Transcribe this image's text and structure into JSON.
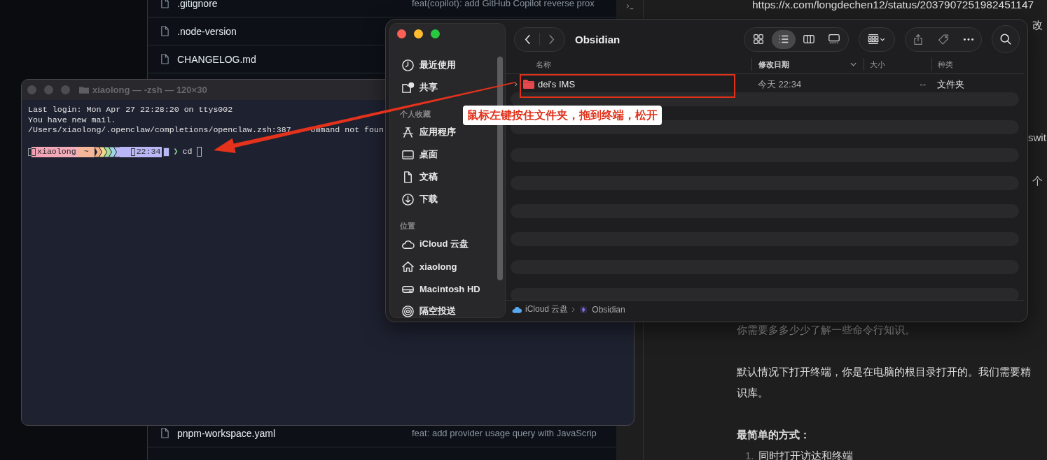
{
  "browser": {
    "files_top": [
      {
        "name": ".gitignore",
        "commit": "feat(copilot): add GitHub Copilot reverse prox"
      },
      {
        "name": ".node-version"
      },
      {
        "name": "CHANGELOG.md"
      }
    ],
    "files_bottom": [
      {
        "name": "pnpm-workspace.yaml",
        "commit": "feat: add provider usage query with JavaScrip"
      }
    ]
  },
  "note": {
    "url": "https://x.com/longdechen12/status/2037907251982451147",
    "edge_fragments": [
      "改",
      "swit",
      "个"
    ],
    "paragraphs": [
      {
        "kind": "muted",
        "lines": [
          "你需要多多少少了解一些命令行知识。"
        ]
      },
      {
        "kind": "normal",
        "lines": [
          "默认情况下打开终端，你是在电脑的根目录打开的。我们需要精",
          "识库。"
        ]
      },
      {
        "kind": "heading",
        "lines": [
          "最简单的方式："
        ]
      }
    ],
    "list": [
      {
        "number": "1.",
        "text": "同时打开访达和终端"
      }
    ]
  },
  "terminal": {
    "title": "xiaolong — -zsh — 120×30",
    "lines": [
      "Last login: Mon Apr 27 22:28:20 on ttys002",
      "You have new mail.",
      {
        "shown": "/Users/xiaolong/.openclaw/completions/openclaw.zsh:387",
        "after_arrow": "ommand not foun"
      }
    ],
    "prompt": {
      "user": "xiaolong",
      "dir": "~",
      "time": "22:34",
      "symbol": "❯",
      "command": "cd"
    }
  },
  "finder": {
    "title": "Obsidian",
    "view_modes": [
      {
        "kind": "icons",
        "selected": false
      },
      {
        "kind": "list",
        "selected": true
      },
      {
        "kind": "columns",
        "selected": false
      },
      {
        "kind": "gallery",
        "selected": false
      }
    ],
    "sidebar": [
      {
        "items": [
          {
            "kind": "clock",
            "label": "最近使用"
          },
          {
            "kind": "shared",
            "label": "共享"
          }
        ]
      },
      {
        "title": "个人收藏",
        "items": [
          {
            "kind": "apps",
            "label": "应用程序"
          },
          {
            "kind": "desktop",
            "label": "桌面"
          },
          {
            "kind": "document",
            "label": "文稿"
          },
          {
            "kind": "download",
            "label": "下载"
          }
        ]
      },
      {
        "title": "位置",
        "items": [
          {
            "kind": "cloud",
            "label": "iCloud 云盘"
          },
          {
            "kind": "home",
            "label": "xiaolong"
          },
          {
            "kind": "drive",
            "label": "Macintosh HD"
          },
          {
            "kind": "airdrop",
            "label": "隔空投送"
          }
        ]
      }
    ],
    "columns": [
      {
        "label": "名称",
        "sorted": false
      },
      {
        "label": "修改日期",
        "sorted": true
      },
      {
        "label": "大小",
        "sorted": false
      },
      {
        "label": "种类",
        "sorted": false
      }
    ],
    "rows": [
      {
        "name": "dei's IMS",
        "modified": "今天 22:34",
        "size": "--",
        "kind_text": "文件夹",
        "expanded": false
      }
    ],
    "path": [
      {
        "kind": "cloud",
        "label": "iCloud 云盘"
      },
      {
        "kind": "app",
        "label": "Obsidian"
      }
    ]
  },
  "annotation": {
    "callout": "鼠标左键按住文件夹，拖到终端，松开"
  }
}
